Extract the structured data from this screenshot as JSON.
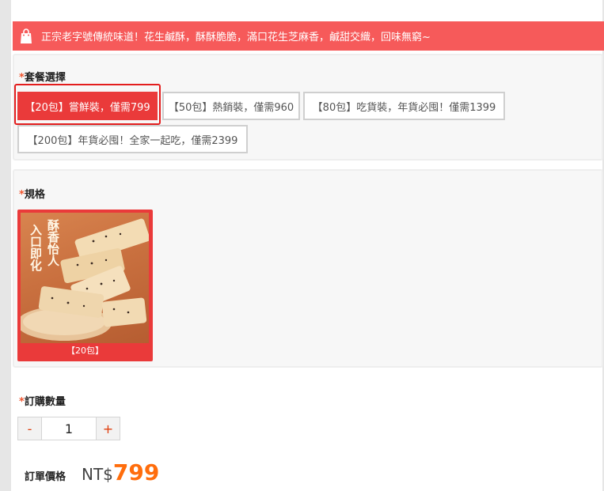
{
  "banner": {
    "text": "正宗老字號傳統味道！花生鹹酥，酥酥脆脆，滿口花生芝麻香，鹹甜交織，回味無窮~",
    "icon": "shopping-bag-icon"
  },
  "package": {
    "required_mark": "*",
    "label": "套餐選擇",
    "options": [
      {
        "label": "【20包】嘗鮮裝，僅需799",
        "selected": true
      },
      {
        "label": "【50包】熱銷裝，僅需960",
        "selected": false
      },
      {
        "label": "【80包】吃貨裝，年貨必囤！僅需1399",
        "selected": false
      },
      {
        "label": "【200包】年貨必囤！全家一起吃，僅需2399",
        "selected": false
      }
    ]
  },
  "spec": {
    "required_mark": "*",
    "label": "規格",
    "card": {
      "caption": "【20包】",
      "image_text_right": "酥香怡人",
      "image_text_left": "入口即化",
      "selected": true
    }
  },
  "quantity": {
    "required_mark": "*",
    "label": "訂購數量",
    "minus": "-",
    "value": "1",
    "plus": "+"
  },
  "price": {
    "label": "訂單價格",
    "currency": "NT$",
    "amount": "799"
  },
  "colors": {
    "accent": "#ea3a3a",
    "banner": "#f65a5a",
    "price": "#ff6d0c",
    "highlight_box": "#e31d1d"
  }
}
